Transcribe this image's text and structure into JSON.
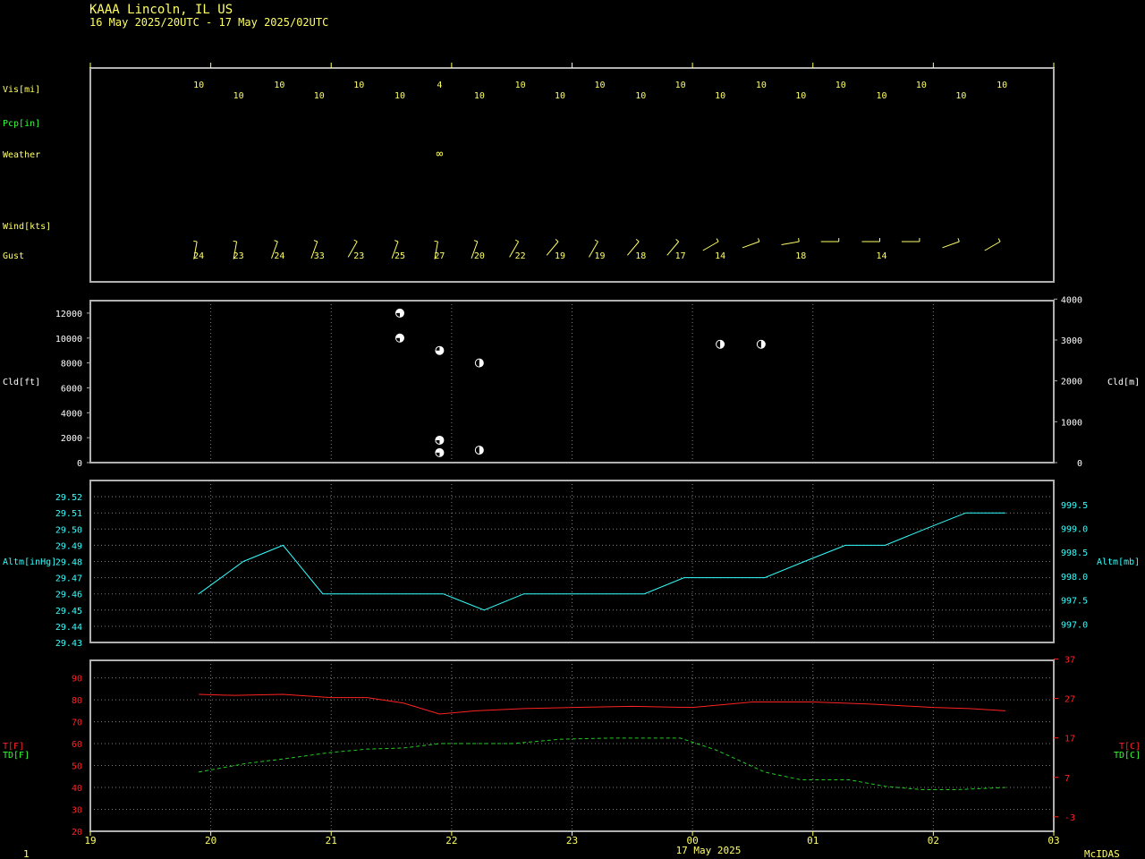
{
  "header": {
    "title": "KAAA  Lincoln, IL US",
    "subtitle": "16 May 2025/20UTC - 17 May 2025/02UTC"
  },
  "footer": {
    "left": "1",
    "date": "17 May 2025",
    "credit": "McIDAS"
  },
  "colors": {
    "yellow": "#ffff66",
    "green": "#33ff33",
    "cyan": "#33ffff",
    "red": "#ff2222",
    "dewpoint": "#22cc22",
    "white": "#ffffff",
    "frame": "#b0b0b0",
    "grid": "#808080"
  },
  "time_axis": {
    "start_hour": 19,
    "end_hour": 27,
    "tick_labels": [
      "19",
      "20",
      "21",
      "22",
      "23",
      "00",
      "01",
      "02",
      "03"
    ]
  },
  "chart_data": [
    {
      "type": "table",
      "panel": "obs",
      "labels": {
        "vis": "Vis[mi]",
        "pcp": "Pcp[in]",
        "weather": "Weather",
        "wind": "Wind[kts]",
        "gust": "Gust"
      },
      "times": [
        19.9,
        20.23,
        20.57,
        20.9,
        21.23,
        21.57,
        21.9,
        22.23,
        22.57,
        22.9,
        23.23,
        23.57,
        23.9,
        24.23,
        24.57,
        24.9,
        25.23,
        25.57,
        25.9,
        26.23,
        26.57
      ],
      "visibility": [
        "10",
        "10",
        "10",
        "10",
        "10",
        "10",
        "4",
        "10",
        "10",
        "10",
        "10",
        "10",
        "10",
        "10",
        "10",
        "10",
        "10",
        "10",
        "10",
        "10",
        "10"
      ],
      "weather": [
        {
          "t": 21.9,
          "symbol": "∞"
        }
      ],
      "wind_dir_deg": [
        190,
        190,
        200,
        200,
        210,
        200,
        190,
        200,
        210,
        220,
        210,
        220,
        220,
        240,
        250,
        260,
        270,
        270,
        270,
        250,
        240
      ],
      "gusts": [
        {
          "t": 19.9,
          "v": "24"
        },
        {
          "t": 20.23,
          "v": "23"
        },
        {
          "t": 20.57,
          "v": "24"
        },
        {
          "t": 20.9,
          "v": "33"
        },
        {
          "t": 21.23,
          "v": "23"
        },
        {
          "t": 21.57,
          "v": "25"
        },
        {
          "t": 21.9,
          "v": "27"
        },
        {
          "t": 22.23,
          "v": "20"
        },
        {
          "t": 22.57,
          "v": "22"
        },
        {
          "t": 22.9,
          "v": "19"
        },
        {
          "t": 23.23,
          "v": "19"
        },
        {
          "t": 23.57,
          "v": "18"
        },
        {
          "t": 23.9,
          "v": "17"
        },
        {
          "t": 24.23,
          "v": "14"
        },
        {
          "t": 24.9,
          "v": "18"
        },
        {
          "t": 25.57,
          "v": "14"
        }
      ]
    },
    {
      "type": "scatter",
      "panel": "cloud",
      "ylabel": "Cld[ft]",
      "ylabel_right": "Cld[m]",
      "ylim": [
        0,
        13000
      ],
      "yticks": [
        0,
        2000,
        4000,
        6000,
        8000,
        10000,
        12000
      ],
      "yticks_right": [
        0,
        1000,
        2000,
        3000,
        4000
      ],
      "points": [
        {
          "t": 21.57,
          "v": 12000,
          "cover": "bkn"
        },
        {
          "t": 21.57,
          "v": 10000,
          "cover": "bkn"
        },
        {
          "t": 21.9,
          "v": 9000,
          "cover": "ovc"
        },
        {
          "t": 21.9,
          "v": 1800,
          "cover": "bkn"
        },
        {
          "t": 21.9,
          "v": 800,
          "cover": "bkn"
        },
        {
          "t": 22.23,
          "v": 8000,
          "cover": "sct"
        },
        {
          "t": 22.23,
          "v": 1000,
          "cover": "sct"
        },
        {
          "t": 24.23,
          "v": 9500,
          "cover": "sct"
        },
        {
          "t": 24.57,
          "v": 9500,
          "cover": "sct"
        }
      ]
    },
    {
      "type": "line",
      "panel": "altimeter",
      "ylabel": "Altm[inHg]",
      "ylabel_right": "Altm[mb]",
      "ylim": [
        29.43,
        29.53
      ],
      "yticks": [
        "29.43",
        "29.44",
        "29.45",
        "29.46",
        "29.47",
        "29.48",
        "29.49",
        "29.50",
        "29.51",
        "29.52"
      ],
      "yticks_right": [
        "997.0",
        "997.5",
        "998.0",
        "998.5",
        "999.0",
        "999.5"
      ],
      "x": [
        19.9,
        20.27,
        20.6,
        20.93,
        21.27,
        21.6,
        21.93,
        22.27,
        22.6,
        22.93,
        23.27,
        23.6,
        23.93,
        24.27,
        24.6,
        24.93,
        25.27,
        25.6,
        25.93,
        26.27,
        26.6
      ],
      "values": [
        29.46,
        29.48,
        29.49,
        29.46,
        29.46,
        29.46,
        29.46,
        29.45,
        29.46,
        29.46,
        29.46,
        29.46,
        29.47,
        29.47,
        29.47,
        29.48,
        29.49,
        29.49,
        29.5,
        29.51,
        29.51
      ]
    },
    {
      "type": "line",
      "panel": "temperature",
      "ylabel": "T[F]",
      "ylabel2": "TD[F]",
      "ylabel_right": "T[C]",
      "ylabel_right2": "TD[C]",
      "ylim": [
        20,
        98
      ],
      "yticks": [
        20,
        30,
        40,
        50,
        60,
        70,
        80,
        90
      ],
      "yticks_right": [
        "-3",
        "7",
        "17",
        "27",
        "37"
      ],
      "series": [
        {
          "line": "solid",
          "x": [
            19.9,
            20.2,
            20.6,
            21.0,
            21.3,
            21.6,
            21.9,
            22.2,
            22.6,
            23.0,
            23.5,
            24.0,
            24.5,
            25.0,
            25.5,
            26.0,
            26.3,
            26.6
          ],
          "values": [
            82.5,
            82,
            82.5,
            81,
            81,
            78.5,
            73.5,
            75,
            76,
            76.5,
            77,
            76.5,
            79,
            79,
            78,
            76.5,
            76,
            75
          ]
        },
        {
          "line": "dashed",
          "x": [
            19.9,
            20.3,
            20.6,
            21.0,
            21.3,
            21.6,
            21.9,
            22.2,
            22.5,
            22.9,
            23.3,
            23.6,
            23.9,
            24.2,
            24.6,
            24.9,
            25.3,
            25.6,
            25.9,
            26.2,
            26.6
          ],
          "values": [
            47,
            51,
            53,
            56,
            57.5,
            58,
            60,
            60,
            60,
            62,
            62.5,
            62.5,
            62.5,
            57,
            47,
            43.5,
            43.5,
            40.5,
            39,
            39,
            40
          ]
        }
      ]
    }
  ]
}
